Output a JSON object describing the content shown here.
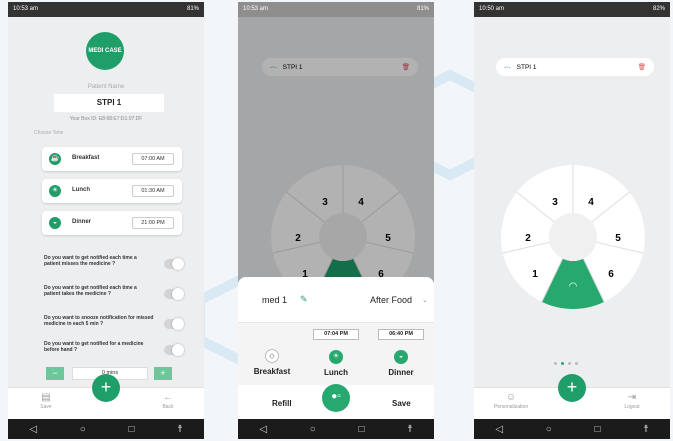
{
  "colors": {
    "accent": "#1f9e6a",
    "accent_light": "#6cc79b",
    "delete": "#e05050"
  },
  "panel1": {
    "status": {
      "time": "10:53 am",
      "battery": "81%"
    },
    "logo_text": "MEDI CASE",
    "patient_name_label": "Patient Name",
    "patient_name_value": "STPI 1",
    "box_id": "Your Box ID: E8:68:E7:D1:07:DF",
    "choose_time_label": "Choose Time",
    "meals": [
      {
        "label": "Breakfast",
        "time": "07:00 AM",
        "icon": "coffee-cup-icon"
      },
      {
        "label": "Lunch",
        "time": "01:30 AM",
        "icon": "sun-icon"
      },
      {
        "label": "Dinner",
        "time": "21:00 PM",
        "icon": "dish-icon"
      }
    ],
    "questions": [
      "Do you want to get notified each time a patient misses the medicine ?",
      "Do you want to get notified each time a patient takes the medicine ?",
      "Do you want to snooze notification for missed medicine in each 5 min ?",
      "Do you want to get notified for a medicine before hand ?"
    ],
    "stepper": {
      "minus": "−",
      "value": "0 mins",
      "plus": "+"
    },
    "bottom": {
      "save": "Save",
      "back": "Back",
      "fab": "+"
    }
  },
  "panel2": {
    "status": {
      "time": "10:53 am",
      "battery": "81%"
    },
    "device_name": "STPI 1",
    "wheel_numbers": [
      "3",
      "4",
      "2",
      "5",
      "1",
      "6"
    ],
    "med_name": "med 1",
    "timing": "After Food",
    "time_lunch": "07:04 PM",
    "time_dinner": "06:40 PM",
    "meals": [
      "Breakfast",
      "Lunch",
      "Dinner"
    ],
    "refill": "Refill",
    "save": "Save"
  },
  "panel3": {
    "status": {
      "time": "10:50 am",
      "battery": "82%"
    },
    "device_name": "STPI 1",
    "wheel_numbers": [
      "3",
      "4",
      "2",
      "5",
      "1",
      "6"
    ],
    "page_dots": 4,
    "active_dot": 1,
    "personalization": "Personalization",
    "logout": "Logout",
    "fab": "+"
  }
}
